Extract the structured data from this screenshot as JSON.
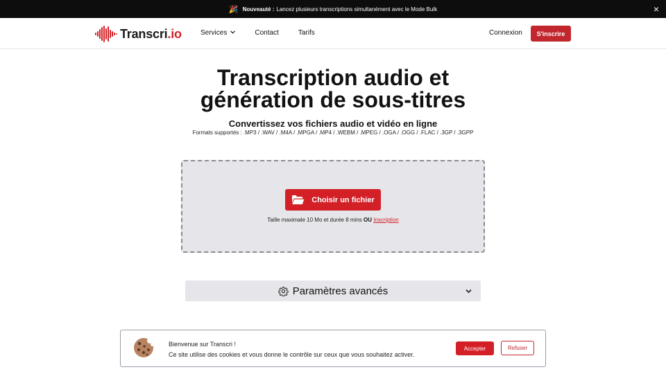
{
  "announcement": {
    "label": "Nouveauté :",
    "text": "Lancez plusieurs transcriptions simultanément avec le Mode Bulk",
    "icon": "party-popper-icon",
    "close_symbol": "×"
  },
  "nav": {
    "logo_main": "Transcri",
    "logo_accent": ".io",
    "menu": [
      {
        "label": "Services",
        "has_dropdown": true
      },
      {
        "label": "Contact"
      },
      {
        "label": "Tarifs"
      }
    ],
    "login": "Connexion",
    "signup": "S'inscrire"
  },
  "hero": {
    "title_line1": "Transcription audio et",
    "title_line2": "génération de sous-titres",
    "subtitle": "Convertissez vos fichiers audio et vidéo en ligne",
    "formats": "Formats supportés : .MP3 / .WAV / .M4A / .MPGA / .MP4 / .WEBM / .MPEG / .OGA / .OGG / .FLAC / .3GP / .3GPP"
  },
  "upload": {
    "button": "Choisir un fichier",
    "limit_text": "Taille maximale 10 Mo et durée 8 mins",
    "or": "OU",
    "signup_link": "Inscription"
  },
  "advanced": {
    "label": "Paramètres avancés"
  },
  "cookie": {
    "line1": "Bienvenue sur Transcri !",
    "line2": "Ce site utilise des cookies et vous donne le contrôle sur ceux que vous souhaitez activer.",
    "accept": "Accepter",
    "refuse": "Refuser"
  },
  "colors": {
    "brand_red": "#d32027",
    "topbar_bg": "#0d0d0d",
    "panel_bg": "#e6e6ea"
  }
}
